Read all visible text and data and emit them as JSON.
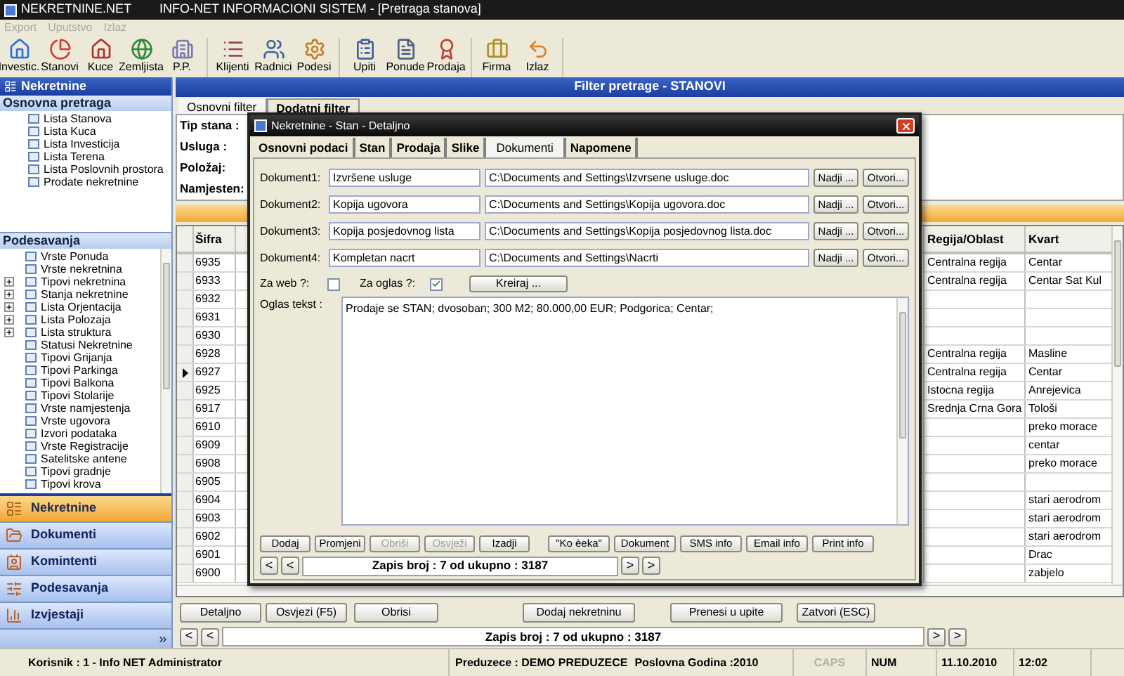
{
  "window": {
    "app_name": "NEKRETNINE.NET",
    "title": "INFO-NET INFORMACIONI SISTEM - [Pretraga stanova]"
  },
  "menu": [
    {
      "label": "Export",
      "disabled": true
    },
    {
      "label": "Uputstvo",
      "disabled": true
    },
    {
      "label": "Izlaz",
      "disabled": true
    }
  ],
  "toolbar": {
    "groups": [
      {
        "items": [
          "Investic.",
          "Stanovi",
          "Kuce",
          "Zemljista",
          "P.P."
        ]
      },
      {
        "items": [
          "Klijenti",
          "Radnici",
          "Podesi"
        ]
      },
      {
        "items": [
          "Upiti",
          "Ponude",
          "Prodaja"
        ]
      },
      {
        "items": [
          "Firma",
          "Izlaz"
        ]
      }
    ]
  },
  "sidebar": {
    "title": "Nekretnine",
    "search_section": {
      "title": "Osnovna pretraga",
      "items": [
        "Lista Stanova",
        "Lista Kuca",
        "Lista Investicija",
        "Lista Terena",
        "Lista Poslovnih prostora",
        "Prodate nekretnine"
      ]
    },
    "settings_section": {
      "title": "Podesavanja",
      "items": [
        {
          "label": "Vrste Ponuda",
          "kind": "leaf"
        },
        {
          "label": "Vrste nekretnina",
          "kind": "leaf"
        },
        {
          "label": "Tipovi nekretnina",
          "kind": "folder"
        },
        {
          "label": "Stanja nekretnine",
          "kind": "folder"
        },
        {
          "label": "Lista Orjentacija",
          "kind": "folder"
        },
        {
          "label": "Lista Polozaja",
          "kind": "folder"
        },
        {
          "label": "Lista struktura",
          "kind": "folder"
        },
        {
          "label": "Statusi Nekretnine",
          "kind": "leaf"
        },
        {
          "label": "Tipovi Grijanja",
          "kind": "leaf"
        },
        {
          "label": "Tipovi Parkinga",
          "kind": "leaf"
        },
        {
          "label": "Tipovi Balkona",
          "kind": "leaf"
        },
        {
          "label": "Tipovi Stolarije",
          "kind": "leaf"
        },
        {
          "label": "Vrste namjestenja",
          "kind": "leaf"
        },
        {
          "label": "Vrste ugovora",
          "kind": "leaf"
        },
        {
          "label": "Izvori podataka",
          "kind": "leaf"
        },
        {
          "label": "Vrste Registracije",
          "kind": "leaf"
        },
        {
          "label": "Satelitske antene",
          "kind": "leaf"
        },
        {
          "label": "Tipovi gradnje",
          "kind": "leaf"
        },
        {
          "label": "Tipovi krova",
          "kind": "leaf"
        }
      ]
    },
    "nav": [
      {
        "label": "Nekretnine",
        "selected": true
      },
      {
        "label": "Dokumenti",
        "selected": false
      },
      {
        "label": "Komintenti",
        "selected": false
      },
      {
        "label": "Podesavanja",
        "selected": false
      },
      {
        "label": "Izvjestaji",
        "selected": false
      }
    ]
  },
  "filter_panel": {
    "title": "Filter pretrage - STANOVI",
    "tabs": [
      {
        "label": "Osnovni filter",
        "selected": true
      },
      {
        "label": "Dodatni filter",
        "selected": false
      }
    ],
    "fields": [
      "Tip stana :",
      "Usluga :",
      "Položaj:",
      "Namjesten:"
    ]
  },
  "table": {
    "columns": [
      "Šifra",
      "Regija/Oblast",
      "Kvart"
    ],
    "rows": [
      {
        "sifra": "6935",
        "regija": "Centralna regija",
        "kvart": "Centar",
        "selected": false
      },
      {
        "sifra": "6933",
        "regija": "Centralna regija",
        "kvart": "Centar Sat Kul",
        "selected": false
      },
      {
        "sifra": "6932",
        "selected": false
      },
      {
        "sifra": "6931",
        "selected": false
      },
      {
        "sifra": "6930",
        "selected": false
      },
      {
        "sifra": "6928",
        "regija": "Centralna regija",
        "kvart": "Masline",
        "selected": false
      },
      {
        "sifra": "6927",
        "regija": "Centralna regija",
        "kvart": "Centar",
        "selected": true
      },
      {
        "sifra": "6925",
        "regija": "Istocna regija",
        "kvart": "Anrejevica",
        "selected": false
      },
      {
        "sifra": "6917",
        "regija": "Srednja Crna Gora",
        "kvart": "Tološi",
        "selected": false
      },
      {
        "sifra": "6910",
        "kvart": "preko morace",
        "selected": false
      },
      {
        "sifra": "6909",
        "kvart": "centar",
        "selected": false
      },
      {
        "sifra": "6908",
        "kvart": "preko morace",
        "selected": false
      },
      {
        "sifra": "6905",
        "selected": false
      },
      {
        "sifra": "6904",
        "kvart": "stari aerodrom",
        "selected": false
      },
      {
        "sifra": "6903",
        "kvart": "stari aerodrom",
        "selected": false
      },
      {
        "sifra": "6902",
        "kvart": "stari aerodrom",
        "selected": false
      },
      {
        "sifra": "6901",
        "kvart": "Drac",
        "selected": false
      },
      {
        "sifra": "6900",
        "kvart": "zabjelo",
        "selected": false
      }
    ]
  },
  "actions": [
    "Detaljno",
    "Osvjezi (F5)",
    "Obrisi",
    "Dodaj nekretninu",
    "Prenesi u upite",
    "Zatvori (ESC)"
  ],
  "pager": {
    "first": "<",
    "prev": "<",
    "status": "Zapis broj : 7 od ukupno : 3187",
    "next": ">",
    "last": ">"
  },
  "dialog": {
    "title": "Nekretnine - Stan - Detaljno",
    "tabs": [
      {
        "label": "Osnovni podaci",
        "selected": false
      },
      {
        "label": "Stan",
        "selected": false
      },
      {
        "label": "Prodaja",
        "selected": false
      },
      {
        "label": "Slike",
        "selected": false
      },
      {
        "label": "Dokumenti",
        "selected": true
      },
      {
        "label": "Napomene",
        "selected": false
      }
    ],
    "documents": [
      {
        "label": "Dokument1:",
        "name": "Izvršene usluge",
        "path": "C:\\Documents and Settings\\Izvrsene usluge.doc",
        "find_button": "Nadji ...",
        "open_button": "Otvori..."
      },
      {
        "label": "Dokument2:",
        "name": "Kopija ugovora",
        "path": "C:\\Documents and Settings\\Kopija ugovora.doc",
        "find_button": "Nadji ...",
        "open_button": "Otvori..."
      },
      {
        "label": "Dokument3:",
        "name": "Kopija posjedovnog lista",
        "path": "C:\\Documents and Settings\\Kopija posjedovnog lista.doc",
        "find_button": "Nadji ...",
        "open_button": "Otvori..."
      },
      {
        "label": "Dokument4:",
        "name": "Kompletan nacrt",
        "path": "C:\\Documents and Settings\\Nacrti",
        "find_button": "Nadji ...",
        "open_button": "Otvori..."
      }
    ],
    "web": {
      "label": "Za web ?:",
      "checked": false
    },
    "ad": {
      "label": "Za oglas ?:",
      "checked": true
    },
    "create_button": "Kreiraj ...",
    "ad_text": {
      "label": "Oglas tekst :",
      "value": "Prodaje se STAN; dvosoban; 300 M2; 80.000,00 EUR; Podgorica; Centar;"
    },
    "edit_buttons": [
      {
        "label": "Dodaj",
        "disabled": false
      },
      {
        "label": "Promjeni",
        "disabled": false
      },
      {
        "label": "Obriši",
        "disabled": true
      },
      {
        "label": "Osvježi",
        "disabled": true
      },
      {
        "label": "Izadji",
        "disabled": false
      }
    ],
    "info_buttons": [
      "\"Ko èeka\"",
      "Dokument",
      "SMS info",
      "Email info",
      "Print info"
    ],
    "pager": {
      "first": "<",
      "prev": "<",
      "status": "Zapis broj : 7 od ukupno : 3187",
      "next": ">",
      "last": ">"
    }
  },
  "status_bar": {
    "user": "Korisnik : 1 - Info NET  Administrator",
    "company": "Preduzece : DEMO PREDUZECE",
    "year": "Poslovna Godina :2010",
    "caps": {
      "label": "CAPS",
      "on": false
    },
    "num": {
      "label": "NUM",
      "on": true
    },
    "date": "11.10.2010",
    "time": "12:02"
  }
}
